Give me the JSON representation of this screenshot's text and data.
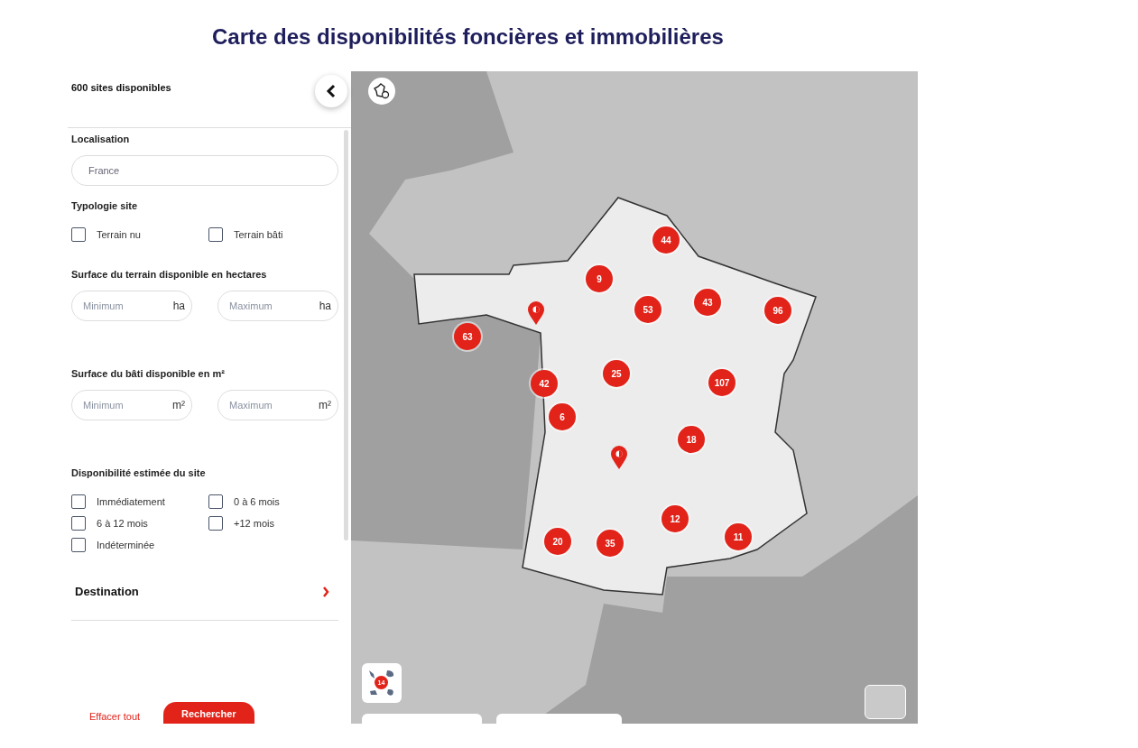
{
  "page_title": "Carte des disponibilités foncières et immobilières",
  "filters": {
    "results_count": "600 sites disponibles",
    "sections": [
      {
        "kind": "text",
        "label": "Localisation",
        "value": "France"
      },
      {
        "kind": "checkboxes",
        "label": "Typologie site",
        "options": [
          {
            "label": "Terrain nu",
            "checked": false
          },
          {
            "label": "Terrain bâti",
            "checked": false
          }
        ]
      },
      {
        "kind": "range",
        "label": "Surface du terrain disponible en hectares",
        "min_placeholder": "Minimum",
        "max_placeholder": "Maximum",
        "min_unit": "ha",
        "max_unit": "ha"
      },
      {
        "kind": "range",
        "label": "Surface du bâti disponible en m²",
        "min_placeholder": "Minimum",
        "max_placeholder": "Maximum",
        "min_unit": "m²",
        "max_unit": "m²"
      },
      {
        "kind": "checkboxes",
        "label": "Disponibilité estimée du site",
        "options": [
          {
            "label": "Immédiatement",
            "checked": false
          },
          {
            "label": "0 à 6 mois",
            "checked": false
          },
          {
            "label": "6 à 12 mois",
            "checked": false
          },
          {
            "label": "+12 mois",
            "checked": false
          },
          {
            "label": "Indéterminée",
            "checked": false
          }
        ]
      },
      {
        "kind": "expander",
        "label": "Destination",
        "expanded": false
      }
    ],
    "clear_button": "Effacer tout",
    "search_button": "Rechercher"
  },
  "map": {
    "markers": [
      {
        "kind": "cluster",
        "count": "44"
      },
      {
        "kind": "cluster",
        "count": "9"
      },
      {
        "kind": "pin"
      },
      {
        "kind": "cluster",
        "count": "53"
      },
      {
        "kind": "cluster",
        "count": "43"
      },
      {
        "kind": "cluster",
        "count": "96"
      },
      {
        "kind": "cluster",
        "count": "63"
      },
      {
        "kind": "cluster",
        "count": "25"
      },
      {
        "kind": "cluster",
        "count": "42"
      },
      {
        "kind": "cluster",
        "count": "107"
      },
      {
        "kind": "cluster",
        "count": "6"
      },
      {
        "kind": "cluster",
        "count": "18"
      },
      {
        "kind": "pin"
      },
      {
        "kind": "cluster",
        "count": "12"
      },
      {
        "kind": "cluster",
        "count": "20"
      },
      {
        "kind": "cluster",
        "count": "35"
      },
      {
        "kind": "cluster",
        "count": "11"
      }
    ],
    "overseas_count": "14"
  }
}
